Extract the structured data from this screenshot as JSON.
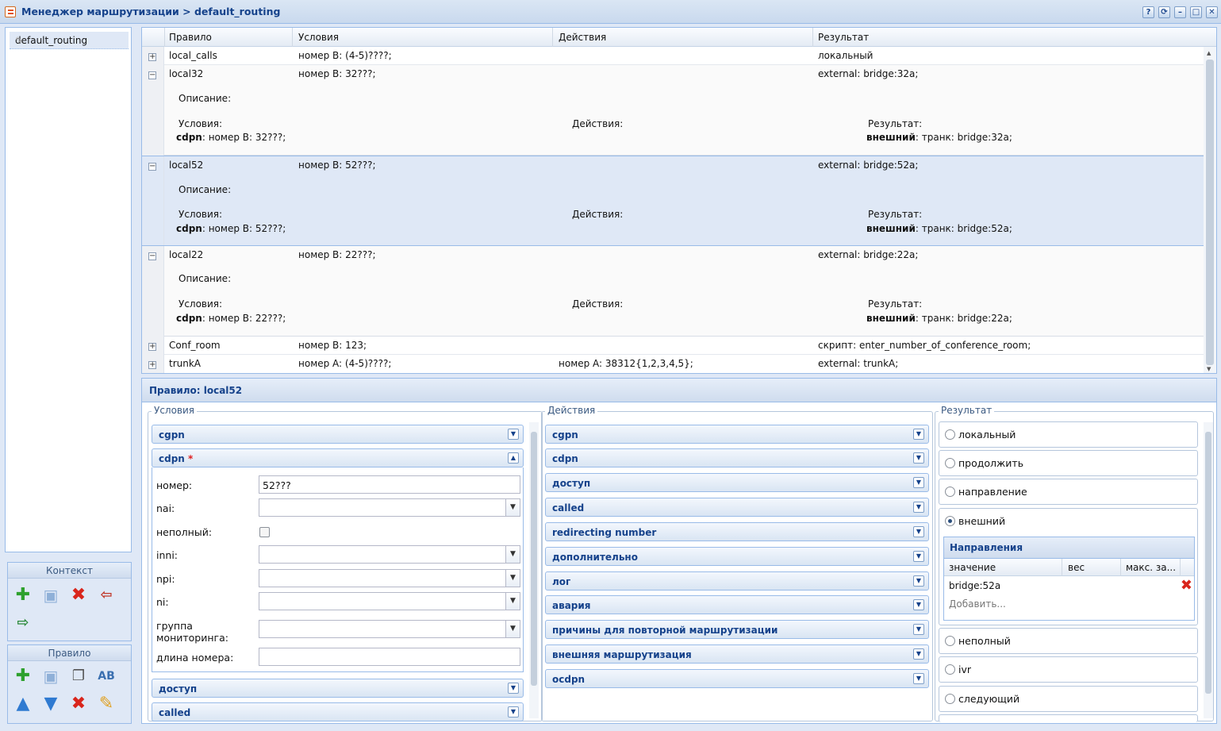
{
  "window": {
    "title": "Менеджер маршрутизации > default_routing",
    "buttons": [
      "?",
      "⟳",
      "–",
      "□",
      "✕"
    ]
  },
  "left": {
    "context_name": "default_routing",
    "context_panel_title": "Контекст",
    "rule_panel_title": "Правило"
  },
  "grid": {
    "headers": [
      "Правило",
      "Условия",
      "Действия",
      "Результат"
    ],
    "rows": [
      {
        "name": "local_calls",
        "cond": "номер B: (4-5)????;",
        "act": "",
        "res": "локальный",
        "expanded": false
      },
      {
        "name": "local32",
        "cond": "номер B: 32???;",
        "act": "",
        "res": "external: bridge:32a;",
        "expanded": true,
        "desc_label": "Описание:",
        "cond_label": "Условия:",
        "cond_key": "cdpn",
        "cond_text": ": номер B: 32???;",
        "act_label": "Действия:",
        "res_label": "Результат:",
        "res_key": "внешний",
        "res_text": ": транк: bridge:32a;"
      },
      {
        "name": "local52",
        "cond": "номер B: 52???;",
        "act": "",
        "res": "external: bridge:52a;",
        "expanded": true,
        "selected": true,
        "desc_label": "Описание:",
        "cond_label": "Условия:",
        "cond_key": "cdpn",
        "cond_text": ": номер B: 52???;",
        "act_label": "Действия:",
        "res_label": "Результат:",
        "res_key": "внешний",
        "res_text": ": транк: bridge:52a;"
      },
      {
        "name": "local22",
        "cond": "номер B: 22???;",
        "act": "",
        "res": "external: bridge:22a;",
        "expanded": true,
        "desc_label": "Описание:",
        "cond_label": "Условия:",
        "cond_key": "cdpn",
        "cond_text": ": номер B: 22???;",
        "act_label": "Действия:",
        "res_label": "Результат:",
        "res_key": "внешний",
        "res_text": ": транк: bridge:22a;"
      },
      {
        "name": "Conf_room",
        "cond": "номер B: 123;",
        "act": "",
        "res": "скрипт: enter_number_of_conference_room;",
        "expanded": false
      },
      {
        "name": "trunkA",
        "cond": "номер A: (4-5)????;",
        "act": "номер A: 38312{1,2,3,4,5};",
        "res": "external: trunkA;",
        "expanded": false
      }
    ]
  },
  "detail": {
    "title": "Правило: local52",
    "conditions": {
      "legend": "Условия",
      "sections": [
        "cgpn",
        "cdpn",
        "доступ",
        "called"
      ],
      "required_mark": "*",
      "fields": [
        {
          "label": "номер:",
          "value": "52???",
          "type": "text"
        },
        {
          "label": "nai:",
          "value": "",
          "type": "select"
        },
        {
          "label": "неполный:",
          "type": "checkbox"
        },
        {
          "label": "inni:",
          "value": "",
          "type": "select"
        },
        {
          "label": "npi:",
          "value": "",
          "type": "select"
        },
        {
          "label": "ni:",
          "value": "",
          "type": "select"
        },
        {
          "label": "группа",
          "label2": "мониторинга:",
          "value": "",
          "type": "select"
        },
        {
          "label": "длина номера:",
          "value": "",
          "type": "text"
        }
      ]
    },
    "actions": {
      "legend": "Действия",
      "sections": [
        "cgpn",
        "cdpn",
        "доступ",
        "called",
        "redirecting number",
        "дополнительно",
        "лог",
        "авария",
        "причины для повторной маршрутизации",
        "внешняя маршрутизация",
        "ocdpn"
      ]
    },
    "result": {
      "legend": "Результат",
      "options": [
        "локальный",
        "продолжить",
        "направление",
        "внешний",
        "неполный",
        "ivr",
        "следующий"
      ],
      "selected": "внешний",
      "directions": {
        "title": "Направления",
        "columns": [
          "значение",
          "вес",
          "макс. за..."
        ],
        "rows": [
          "bridge:52a"
        ],
        "add_label": "Добавить..."
      }
    }
  }
}
